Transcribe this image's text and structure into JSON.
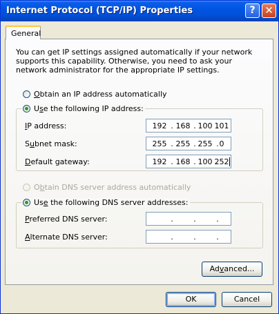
{
  "window": {
    "title": "Internet Protocol (TCP/IP) Properties",
    "help_glyph": "?",
    "close_glyph": "✕"
  },
  "tabs": [
    {
      "label": "General",
      "selected": true
    }
  ],
  "description": "You can get IP settings assigned automatically if your network supports this capability. Otherwise, you need to ask your network administrator for the appropriate IP settings.",
  "ip_section": {
    "auto_option": {
      "prefix": "",
      "accel": "O",
      "rest": "btain an IP address automatically",
      "selected": false
    },
    "manual_option": {
      "prefix": "U",
      "accel": "s",
      "rest": "e the following IP address:",
      "selected": true
    },
    "fields": [
      {
        "prefix": "",
        "accel": "I",
        "rest": "P address:",
        "octets": [
          "192",
          "168",
          "100",
          "101"
        ]
      },
      {
        "prefix": "S",
        "accel": "u",
        "rest": "bnet mask:",
        "octets": [
          "255",
          "255",
          "255",
          "0"
        ]
      },
      {
        "prefix": "",
        "accel": "D",
        "rest": "efault gateway:",
        "octets": [
          "192",
          "168",
          "100",
          "252"
        ]
      }
    ]
  },
  "dns_section": {
    "auto_option": {
      "prefix": "O",
      "accel": "b",
      "rest": "tain DNS server address automatically",
      "selected": false,
      "disabled": true
    },
    "manual_option": {
      "prefix": "Us",
      "accel": "e",
      "rest": " the following DNS server addresses:",
      "selected": true
    },
    "fields": [
      {
        "prefix": "",
        "accel": "P",
        "rest": "referred DNS server:",
        "octets": [
          "",
          "",
          "",
          ""
        ]
      },
      {
        "prefix": "",
        "accel": "A",
        "rest": "lternate DNS server:",
        "octets": [
          "",
          "",
          "",
          ""
        ]
      }
    ]
  },
  "buttons": {
    "advanced": {
      "prefix": "Ad",
      "accel": "v",
      "rest": "anced..."
    },
    "ok": "OK",
    "cancel": "Cancel"
  },
  "octet_separator": "."
}
